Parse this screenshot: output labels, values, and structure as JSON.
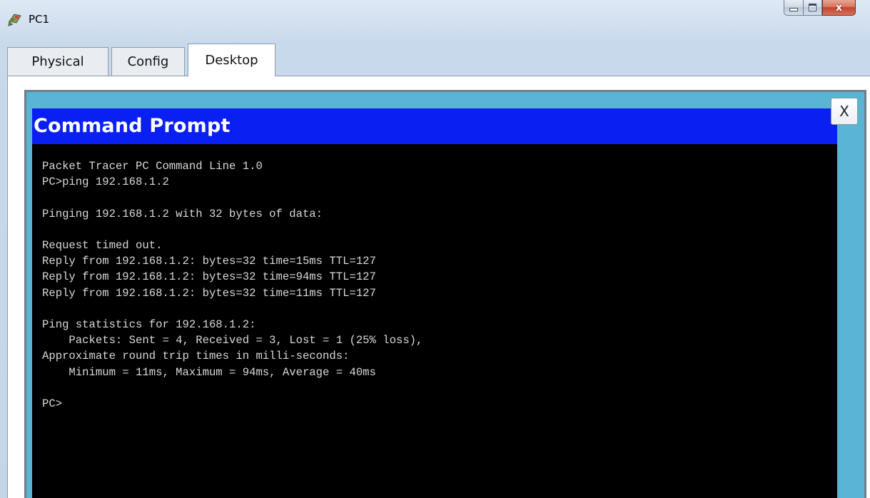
{
  "window": {
    "title": "PC1",
    "controls": {
      "minimize_icon": "minimize-icon",
      "maximize_icon": "maximize-icon",
      "close_label": "x"
    }
  },
  "tabs": [
    {
      "label": "Physical",
      "active": false
    },
    {
      "label": "Config",
      "active": false
    },
    {
      "label": "Desktop",
      "active": true
    }
  ],
  "command_prompt": {
    "title": "Command Prompt",
    "close_label": "X",
    "lines": [
      "Packet Tracer PC Command Line 1.0",
      "PC>ping 192.168.1.2",
      "",
      "Pinging 192.168.1.2 with 32 bytes of data:",
      "",
      "Request timed out.",
      "Reply from 192.168.1.2: bytes=32 time=15ms TTL=127",
      "Reply from 192.168.1.2: bytes=32 time=94ms TTL=127",
      "Reply from 192.168.1.2: bytes=32 time=11ms TTL=127",
      "",
      "Ping statistics for 192.168.1.2:",
      "    Packets: Sent = 4, Received = 3, Lost = 1 (25% loss),",
      "Approximate round trip times in milli-seconds:",
      "    Minimum = 11ms, Maximum = 94ms, Average = 40ms",
      "",
      "PC>"
    ]
  },
  "colors": {
    "cmd_title_bar": "#0a1ff2",
    "cmd_background": "#000000",
    "cmd_text": "#d9d9d9",
    "desktop_frame": "#5ab4d3"
  }
}
